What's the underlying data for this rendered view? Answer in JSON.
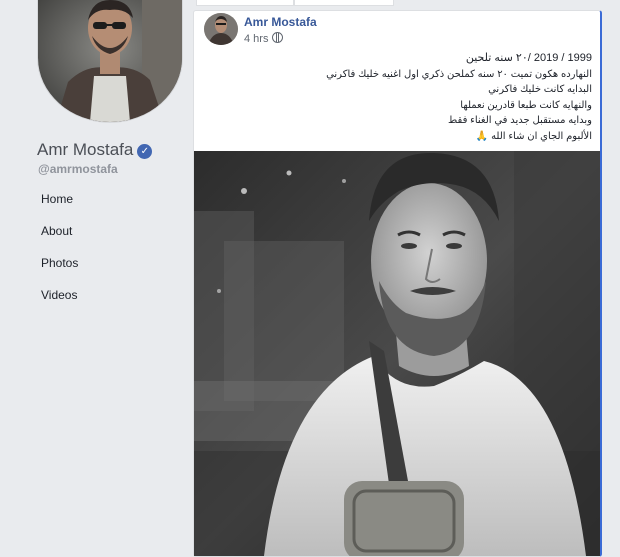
{
  "page": {
    "name": "Amr Mostafa",
    "handle": "@amrmostafa",
    "verified_icon": "check-icon"
  },
  "nav": {
    "items": [
      {
        "label": "Home"
      },
      {
        "label": "About"
      },
      {
        "label": "Photos"
      },
      {
        "label": "Videos"
      }
    ]
  },
  "post": {
    "author": "Amr Mostafa",
    "time": "4 hrs",
    "privacy_icon": "globe-icon",
    "lines": [
      "1999 / 2019 /٢٠ سنه تلحين",
      "النهارده هكون تميت ٢٠ سنه كملحن ذكري اول اغنيه خليك فاكرني",
      "البدايه كانت خليك فاكرني",
      "والنهايه كانت طبعا قادرين نعملها",
      "وبدايه مستقبل جديد في الغناء فقط",
      "الألبوم الجاي ان شاء الله 🙏"
    ]
  },
  "colors": {
    "background": "#e9ebee",
    "link": "#385898",
    "verified": "#4267b2"
  }
}
